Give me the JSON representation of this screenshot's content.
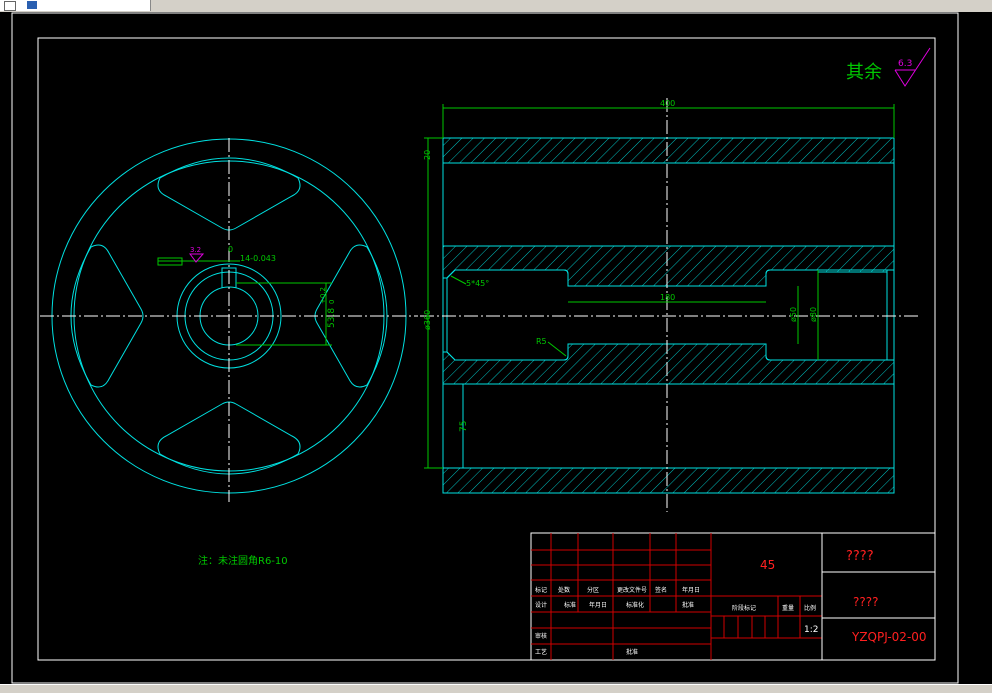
{
  "window": {
    "tab_label": ""
  },
  "roughness": {
    "label": "其余",
    "value": "6.3"
  },
  "left_view": {
    "tol_value": "3.2",
    "keyway_dim_upper": "0",
    "keyway_dim": "14-0.043",
    "depth_dim": "53.8",
    "depth_tol": "+0.2",
    "depth_tol_low": "0"
  },
  "right_view": {
    "overall_length": "400",
    "top_thick": "20",
    "outer_dia": "ø360",
    "chamfer": "5*45°",
    "bore_length": "180",
    "radius": "R5",
    "inner_dia1": "ø50",
    "inner_dia2": "ø80",
    "wall": "75"
  },
  "note": "注：未注圆角R6-10",
  "title_block": {
    "material": "45",
    "name": "????",
    "company": "????",
    "drawing_no": "YZQPJ-02-00",
    "scale": "1:2",
    "row_labels_a": [
      "标记",
      "处数",
      "分区",
      "更改文件号",
      "签名",
      "年月日"
    ],
    "row_labels_b": [
      "设计",
      "标准",
      "年月日",
      "标准化",
      "",
      "批准"
    ],
    "row_labels_c": [
      "审核",
      "",
      "",
      "",
      "",
      ""
    ],
    "row_labels_d": [
      "工艺",
      "",
      "批准",
      "",
      "",
      ""
    ],
    "stage_labels": [
      "阶段标记",
      "重量",
      "比例"
    ]
  }
}
